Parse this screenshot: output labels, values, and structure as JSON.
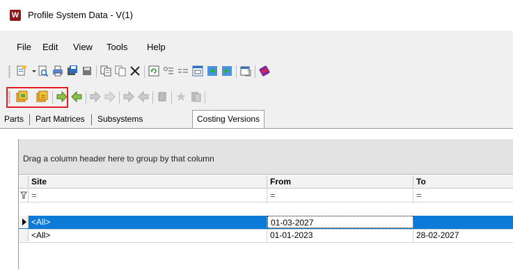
{
  "window": {
    "title": "Profile System Data - V(1)",
    "icon_letter": "W"
  },
  "menu": [
    "File",
    "Edit",
    "View",
    "Tools",
    "Help"
  ],
  "tabs": [
    "Parts",
    "Part Matrices",
    "Subsystems",
    "Costing Versions"
  ],
  "active_tab": "Costing Versions",
  "grid": {
    "group_hint": "Drag a column header here to group by that column",
    "columns": [
      "Site",
      "From",
      "To"
    ],
    "filter_symbol": "=",
    "rows": [
      {
        "site": "<All>",
        "from": "01-03-2027",
        "to": "",
        "selected": true
      },
      {
        "site": "<All>",
        "from": "01-01-2023",
        "to": "28-02-2027",
        "selected": false
      }
    ]
  },
  "colors": {
    "selection": "#0c7bd8",
    "highlight_box": "#e21d1d"
  }
}
